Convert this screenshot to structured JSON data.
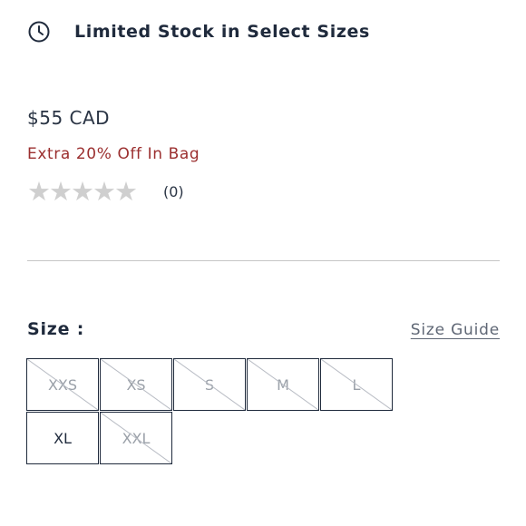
{
  "stock": {
    "icon": "clock-icon",
    "text": "Limited Stock in Select Sizes"
  },
  "product": {
    "price": "$55 CAD",
    "promo": "Extra 20% Off In Bag",
    "promo_color": "#9b2f2f",
    "rating": {
      "stars": 0,
      "max_stars": 5,
      "count_text": "(0)"
    }
  },
  "size_section": {
    "label": "Size :",
    "guide_link": "Size Guide",
    "sizes": [
      {
        "label": "XXS",
        "available": false
      },
      {
        "label": "XS",
        "available": false
      },
      {
        "label": "S",
        "available": false
      },
      {
        "label": "M",
        "available": false
      },
      {
        "label": "L",
        "available": false
      },
      {
        "label": "XL",
        "available": true
      },
      {
        "label": "XXL",
        "available": false
      }
    ]
  },
  "colors": {
    "text": "#1f2a3c",
    "star_empty": "#cfcfcf",
    "divider": "#c6c6c6"
  }
}
